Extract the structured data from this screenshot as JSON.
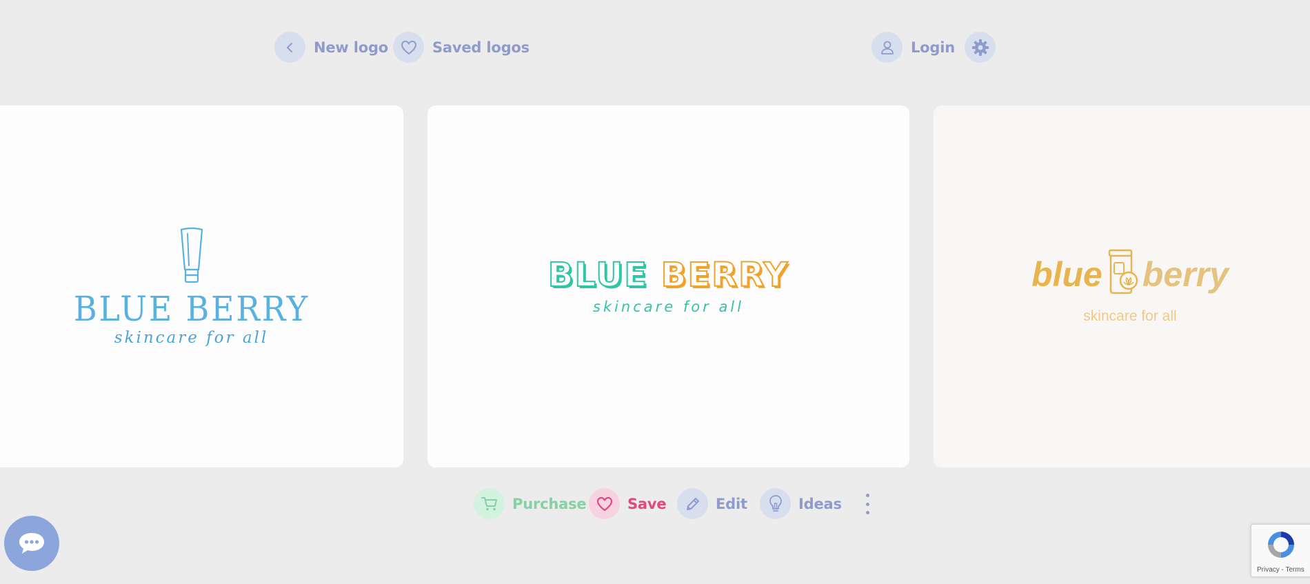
{
  "nav": {
    "new_logo": "New logo",
    "saved_logos": "Saved logos",
    "login": "Login"
  },
  "logos": [
    {
      "name": "BLUE BERRY",
      "tagline": "skincare for all",
      "primary": "#58b1e0"
    },
    {
      "name_part1": "BLUE",
      "name_part2": "BERRY",
      "tagline": "skincare for all",
      "colors": [
        "#2fc6a6",
        "#f0a22a"
      ]
    },
    {
      "name_part1": "blue",
      "name_part2": "berry",
      "tagline": "skincare for all",
      "colors": [
        "#e8b44d",
        "#e6c27f"
      ]
    }
  ],
  "actions": {
    "purchase": "Purchase",
    "save": "Save",
    "edit": "Edit",
    "ideas": "Ideas"
  },
  "recaptcha": {
    "links": "Privacy - Terms"
  },
  "icons": [
    "chevron-left-icon",
    "heart-icon",
    "user-icon",
    "gear-icon",
    "cart-icon",
    "pencil-icon",
    "lightbulb-icon",
    "more-vertical-icon",
    "chat-icon",
    "recaptcha-icon"
  ]
}
